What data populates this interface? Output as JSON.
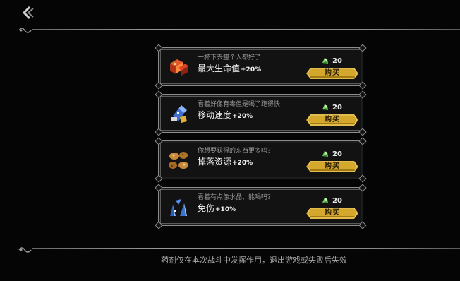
{
  "header": {
    "back_icon": "back-arrow-icon"
  },
  "shop_items": [
    {
      "icon": "red-gem-potion-icon",
      "flavor": "一杯下去整个人都好了",
      "stat": "最大生命值",
      "value": "+20%",
      "price": "20",
      "currency_icon": "green-crystal-icon",
      "buy_label": "购买"
    },
    {
      "icon": "blue-vial-potion-icon",
      "flavor": "看着好像有毒但是喝了跑得快",
      "stat": "移动速度",
      "value": "+20%",
      "price": "20",
      "currency_icon": "green-crystal-icon",
      "buy_label": "购买"
    },
    {
      "icon": "gold-ore-potion-icon",
      "flavor": "你想要获得的东西更多吗？",
      "stat": "掉落资源",
      "value": "+20%",
      "price": "20",
      "currency_icon": "green-crystal-icon",
      "buy_label": "购买"
    },
    {
      "icon": "blue-crystal-shards-icon",
      "flavor": "看着有点像水晶，能喝吗？",
      "stat": "免伤",
      "value": "+10%",
      "price": "20",
      "currency_icon": "green-crystal-icon",
      "buy_label": "购买"
    }
  ],
  "footer": {
    "notice": "药剂仅在本次战斗中发挥作用，退出游戏或失败后失效"
  },
  "colors": {
    "background": "#050505",
    "button_gold": "#d4a82c",
    "border": "#8d8d8d"
  }
}
